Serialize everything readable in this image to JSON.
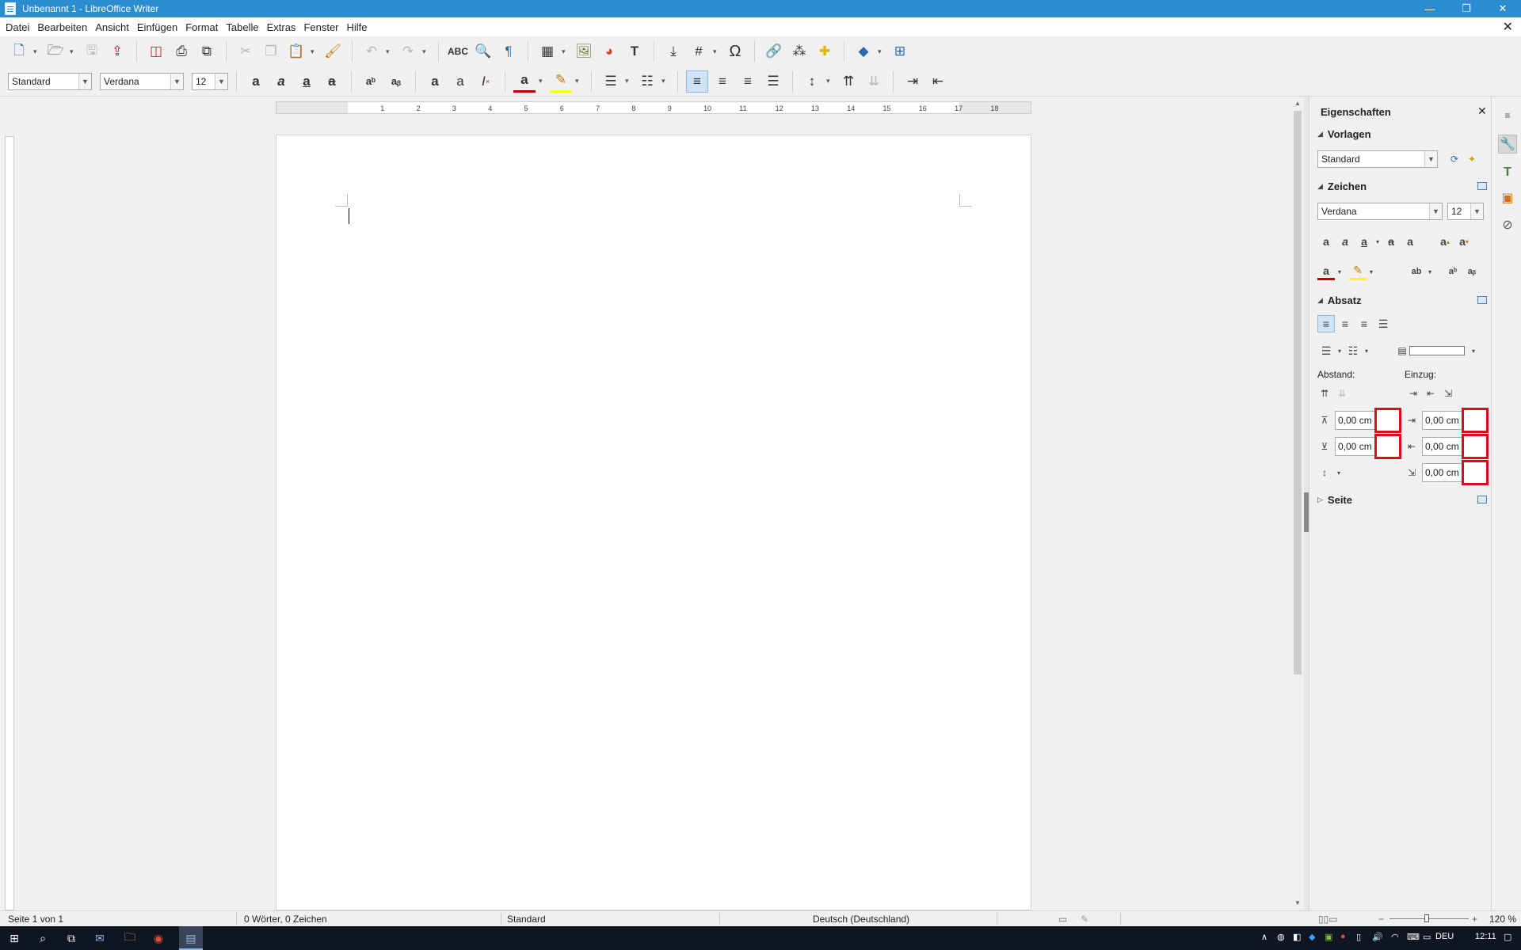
{
  "window": {
    "title": "Unbenannt 1 - LibreOffice Writer",
    "minimize_glyph": "—",
    "restore_glyph": "❐",
    "close_glyph": "✕",
    "doc_close_glyph": "✕"
  },
  "menu": [
    "Datei",
    "Bearbeiten",
    "Ansicht",
    "Einfügen",
    "Format",
    "Tabelle",
    "Extras",
    "Fenster",
    "Hilfe"
  ],
  "toolbar2": {
    "paragraph_style": "Standard",
    "font_name": "Verdana",
    "font_size": "12"
  },
  "ruler": {
    "ticks": [
      "1",
      "2",
      "3",
      "4",
      "5",
      "6",
      "7",
      "8",
      "9",
      "10",
      "11",
      "12",
      "13",
      "14",
      "15",
      "16",
      "17",
      "18"
    ]
  },
  "sidebar": {
    "title": "Eigenschaften",
    "close_glyph": "✕",
    "sections": {
      "vorlagen": "Vorlagen",
      "zeichen": "Zeichen",
      "absatz": "Absatz",
      "seite": "Seite"
    },
    "style_value": "Standard",
    "font_value": "Verdana",
    "size_value": "12",
    "abstand_label": "Abstand:",
    "einzug_label": "Einzug:",
    "spacing_above": "0,00 cm",
    "spacing_below": "0,00 cm",
    "indent_before": "0,00 cm",
    "indent_after": "0,00 cm",
    "indent_first_line": "0,00 cm"
  },
  "status": {
    "page": "Seite 1 von 1",
    "words": "0 Wörter, 0 Zeichen",
    "page_style": "Standard",
    "language": "Deutsch (Deutschland)",
    "zoom": "120 %"
  },
  "taskbar": {
    "keyboard": "DEU",
    "clock": "12:11"
  },
  "colors": {
    "titlebar": "#2b8ccf",
    "highlight_box": "#d90b1c",
    "taskbar": "#101522"
  }
}
